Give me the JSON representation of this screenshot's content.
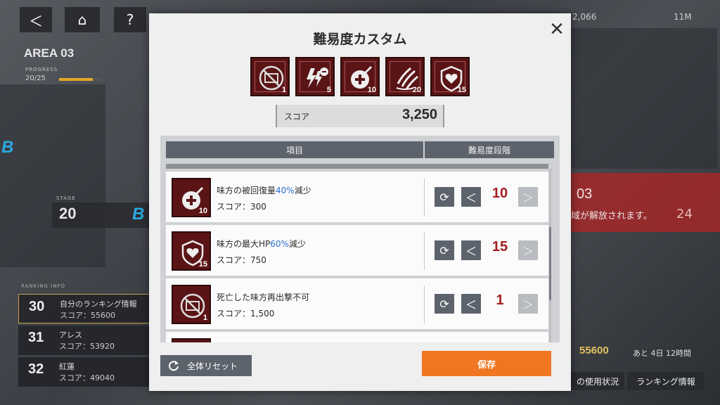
{
  "background": {
    "top_buttons": [
      {
        "icon": "back-icon",
        "glyph": "＜"
      },
      {
        "icon": "home-icon",
        "glyph": "⌂"
      },
      {
        "icon": "help-icon",
        "glyph": "?"
      }
    ],
    "area_name": "AREA 03",
    "progress_label": "PROGRESS",
    "progress_text": "20/25",
    "progress_fraction": 0.8,
    "stage_label": "STAGE",
    "stage_number": "20",
    "stage_mark": "B",
    "side_mark": "B",
    "ranking_label": "RANKING INFO",
    "ranking": [
      {
        "rank": "30",
        "name": "自分のランキング情報",
        "score": "スコア：55600",
        "me": true
      },
      {
        "rank": "31",
        "name": "アレス",
        "score": "スコア：53920",
        "me": false
      },
      {
        "rank": "32",
        "name": "紅蓮",
        "score": "スコア：49040",
        "me": false
      }
    ],
    "currency_1": "2,066",
    "currency_2": "11M",
    "banner_title": "03",
    "banner_text": "域が解放されます。",
    "banner_side": "24",
    "bottom_score": "55600",
    "bottom_remaining": "あと 4日 12時間",
    "bottom_tab_usage": "の使用状況",
    "bottom_tab_ranking": "ランキング情報"
  },
  "modal": {
    "title": "難易度カスタム",
    "close_glyph": "✕",
    "active_modifiers": [
      {
        "name": "no-redeploy",
        "count": "1"
      },
      {
        "name": "energy-down",
        "count": "5"
      },
      {
        "name": "heal-down",
        "count": "10"
      },
      {
        "name": "claw",
        "count": "20"
      },
      {
        "name": "maxhp-down",
        "count": "15"
      }
    ],
    "score_label": "スコア",
    "score_value": "3,250",
    "table_headers": {
      "item": "項目",
      "level": "難易度段階"
    },
    "rows": [
      {
        "icon": "heal-down",
        "icon_count": "10",
        "text_before": "味方の被回復量",
        "highlight": "40%",
        "text_after": "減少",
        "score": "スコア：300",
        "level": "10"
      },
      {
        "icon": "maxhp-down",
        "icon_count": "15",
        "text_before": "味方の最大HP",
        "highlight": "60%",
        "text_after": "減少",
        "score": "スコア：750",
        "level": "15"
      },
      {
        "icon": "no-redeploy",
        "icon_count": "1",
        "text_before": "死亡した味方再出撃不可",
        "highlight": "",
        "text_after": "",
        "score": "スコア：1,500",
        "level": "1"
      }
    ],
    "control_glyphs": {
      "reset": "⟳",
      "dec": "＜",
      "inc": "＞"
    },
    "reset_all_label": "全体リセット",
    "save_label": "保存"
  },
  "colors": {
    "modifier_bg": "#5b1416",
    "level_text": "#a41e22",
    "highlight_text": "#2d6fd0",
    "save_button": "#f07622",
    "control_button": "#5d636c"
  }
}
